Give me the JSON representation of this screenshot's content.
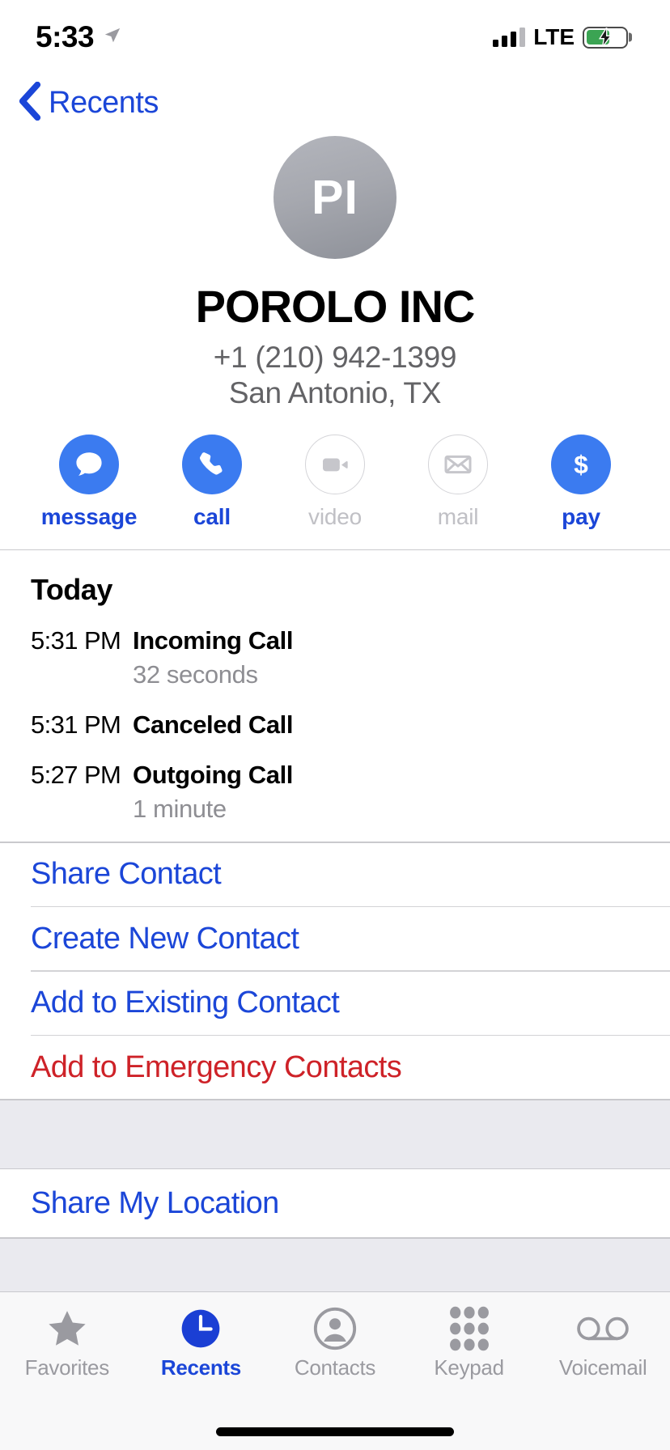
{
  "status_bar": {
    "time": "5:33",
    "location_icon": "location-arrow-icon",
    "carrier": "LTE",
    "signal_icon": "signal-bars-icon",
    "signal_bars_filled": 3,
    "signal_bars_total": 4,
    "battery_icon": "battery-charging-icon",
    "battery_color": "#3ba453"
  },
  "nav": {
    "back_label": "Recents",
    "back_icon": "chevron-left-icon",
    "accent": "#1b46d8"
  },
  "contact": {
    "initials": "PI",
    "name": "POROLO INC",
    "phone": "+1 (210) 942-1399",
    "location": "San Antonio, TX"
  },
  "actions": [
    {
      "id": "message",
      "label": "message",
      "icon": "message-bubble-icon",
      "enabled": true
    },
    {
      "id": "call",
      "label": "call",
      "icon": "phone-handset-icon",
      "enabled": true
    },
    {
      "id": "video",
      "label": "video",
      "icon": "video-camera-icon",
      "enabled": false
    },
    {
      "id": "mail",
      "label": "mail",
      "icon": "envelope-icon",
      "enabled": false
    },
    {
      "id": "pay",
      "label": "pay",
      "icon": "dollar-sign-icon",
      "enabled": true
    }
  ],
  "call_history": {
    "section_title": "Today",
    "entries": [
      {
        "time": "5:31 PM",
        "kind": "Incoming Call",
        "duration": "32 seconds"
      },
      {
        "time": "5:31 PM",
        "kind": "Canceled Call",
        "duration": ""
      },
      {
        "time": "5:27 PM",
        "kind": "Outgoing Call",
        "duration": "1 minute"
      }
    ]
  },
  "menu": [
    {
      "id": "share-contact",
      "label": "Share Contact",
      "style": "blue"
    },
    {
      "id": "create-new-contact",
      "label": "Create New Contact",
      "style": "blue"
    },
    {
      "id": "add-existing-contact",
      "label": "Add to Existing Contact",
      "style": "blue"
    },
    {
      "id": "add-emergency",
      "label": "Add to Emergency Contacts",
      "style": "red"
    }
  ],
  "share_location": {
    "label": "Share My Location"
  },
  "tab_bar": {
    "active": "Recents",
    "tabs": [
      {
        "id": "favorites",
        "label": "Favorites",
        "icon": "star-icon",
        "active": false
      },
      {
        "id": "recents",
        "label": "Recents",
        "icon": "clock-icon",
        "active": true
      },
      {
        "id": "contacts",
        "label": "Contacts",
        "icon": "person-circle-icon",
        "active": false
      },
      {
        "id": "keypad",
        "label": "Keypad",
        "icon": "keypad-dots-icon",
        "active": false
      },
      {
        "id": "voicemail",
        "label": "Voicemail",
        "icon": "voicemail-icon",
        "active": false
      }
    ]
  },
  "colors": {
    "accent_blue": "#1b46d8",
    "button_blue": "#3b7bf0",
    "danger_red": "#ce2228",
    "gray_text": "#8e8e93",
    "gap_bg": "#eaeaef"
  }
}
